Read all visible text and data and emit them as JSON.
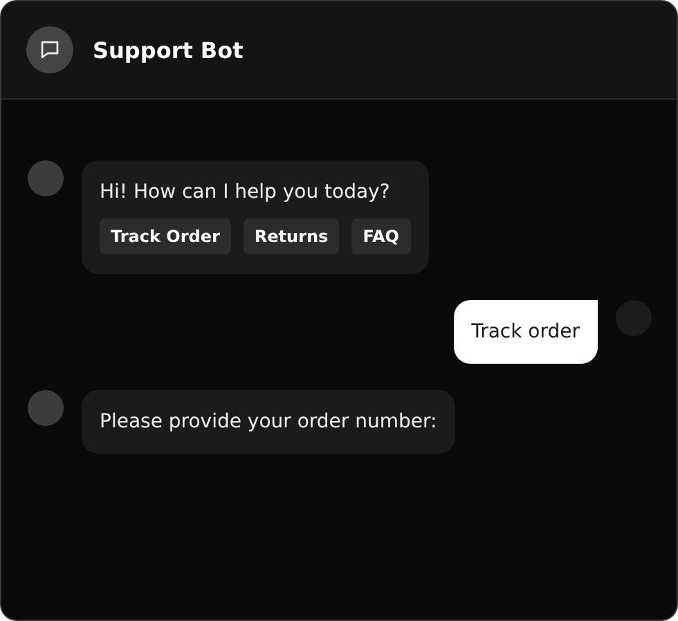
{
  "header": {
    "title": "Support Bot"
  },
  "messages": [
    {
      "kind": "bot",
      "text": "Hi! How can I help you today?",
      "quick_replies": [
        "Track Order",
        "Returns",
        "FAQ"
      ]
    },
    {
      "kind": "user",
      "text": "Track order"
    },
    {
      "kind": "bot",
      "text": "Please provide your order number:"
    }
  ]
}
